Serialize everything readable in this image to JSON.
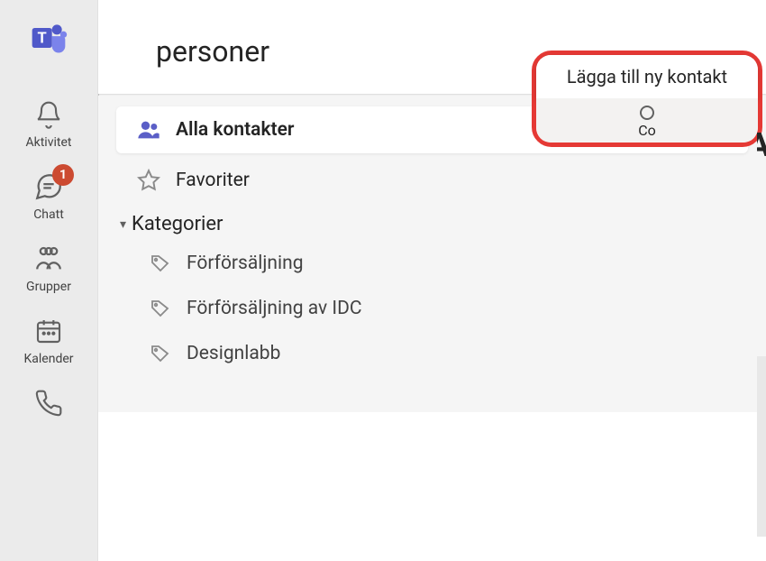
{
  "nav": {
    "items": [
      {
        "label": "Aktivitet",
        "icon": "bell-icon",
        "badge": null
      },
      {
        "label": "Chatt",
        "icon": "chat-icon",
        "badge": "1"
      },
      {
        "label": "Grupper",
        "icon": "team-icon",
        "badge": null
      },
      {
        "label": "Kalender",
        "icon": "calendar-icon",
        "badge": null
      },
      {
        "label": "",
        "icon": "phone-icon",
        "badge": null
      }
    ]
  },
  "panel": {
    "title": "personer",
    "all_contacts": "Alla kontakter",
    "favorites": "Favoriter",
    "categories_header": "Kategorier",
    "categories": [
      {
        "label": "Förförsäljning"
      },
      {
        "label": "Förförsäljning av IDC"
      },
      {
        "label": "Designlabb"
      }
    ]
  },
  "callout": {
    "title": "Lägga till ny kontakt",
    "sub": "Co"
  }
}
